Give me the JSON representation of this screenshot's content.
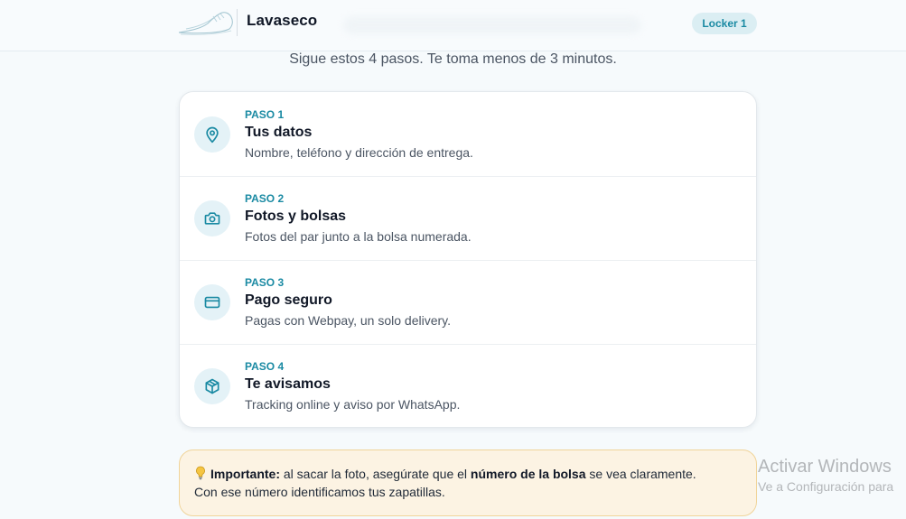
{
  "header": {
    "brand": "Lavaseco",
    "locker_badge": "Locker 1"
  },
  "subtitle": "Sigue estos 4 pasos. Te toma menos de 3 minutos.",
  "steps": [
    {
      "kicker": "PASO 1",
      "title": "Tus datos",
      "description": "Nombre, teléfono y dirección de entrega.",
      "icon": "location-pin-icon"
    },
    {
      "kicker": "PASO 2",
      "title": "Fotos y bolsas",
      "description": "Fotos del par junto a la bolsa numerada.",
      "icon": "camera-icon"
    },
    {
      "kicker": "PASO 3",
      "title": "Pago seguro",
      "description": "Pagas con Webpay, un solo delivery.",
      "icon": "credit-card-icon"
    },
    {
      "kicker": "PASO 4",
      "title": "Te avisamos",
      "description": "Tracking online y aviso por WhatsApp.",
      "icon": "package-icon"
    }
  ],
  "notice": {
    "icon": "lightbulb-icon",
    "label": "Importante:",
    "text_1": "al sacar la foto, asegúrate que el",
    "emphasis": "número de la bolsa",
    "text_2": "se vea claramente.",
    "line_2": "Con ese número identificamos tus zapatillas."
  },
  "watermark": {
    "title": "Activar Windows",
    "subtitle": "Ve a Configuración para"
  },
  "colors": {
    "accent": "#1a8aa3",
    "icon_bg": "#e4f2f7",
    "notice_bg": "#fcf3e3",
    "notice_border": "#f0d49a"
  }
}
